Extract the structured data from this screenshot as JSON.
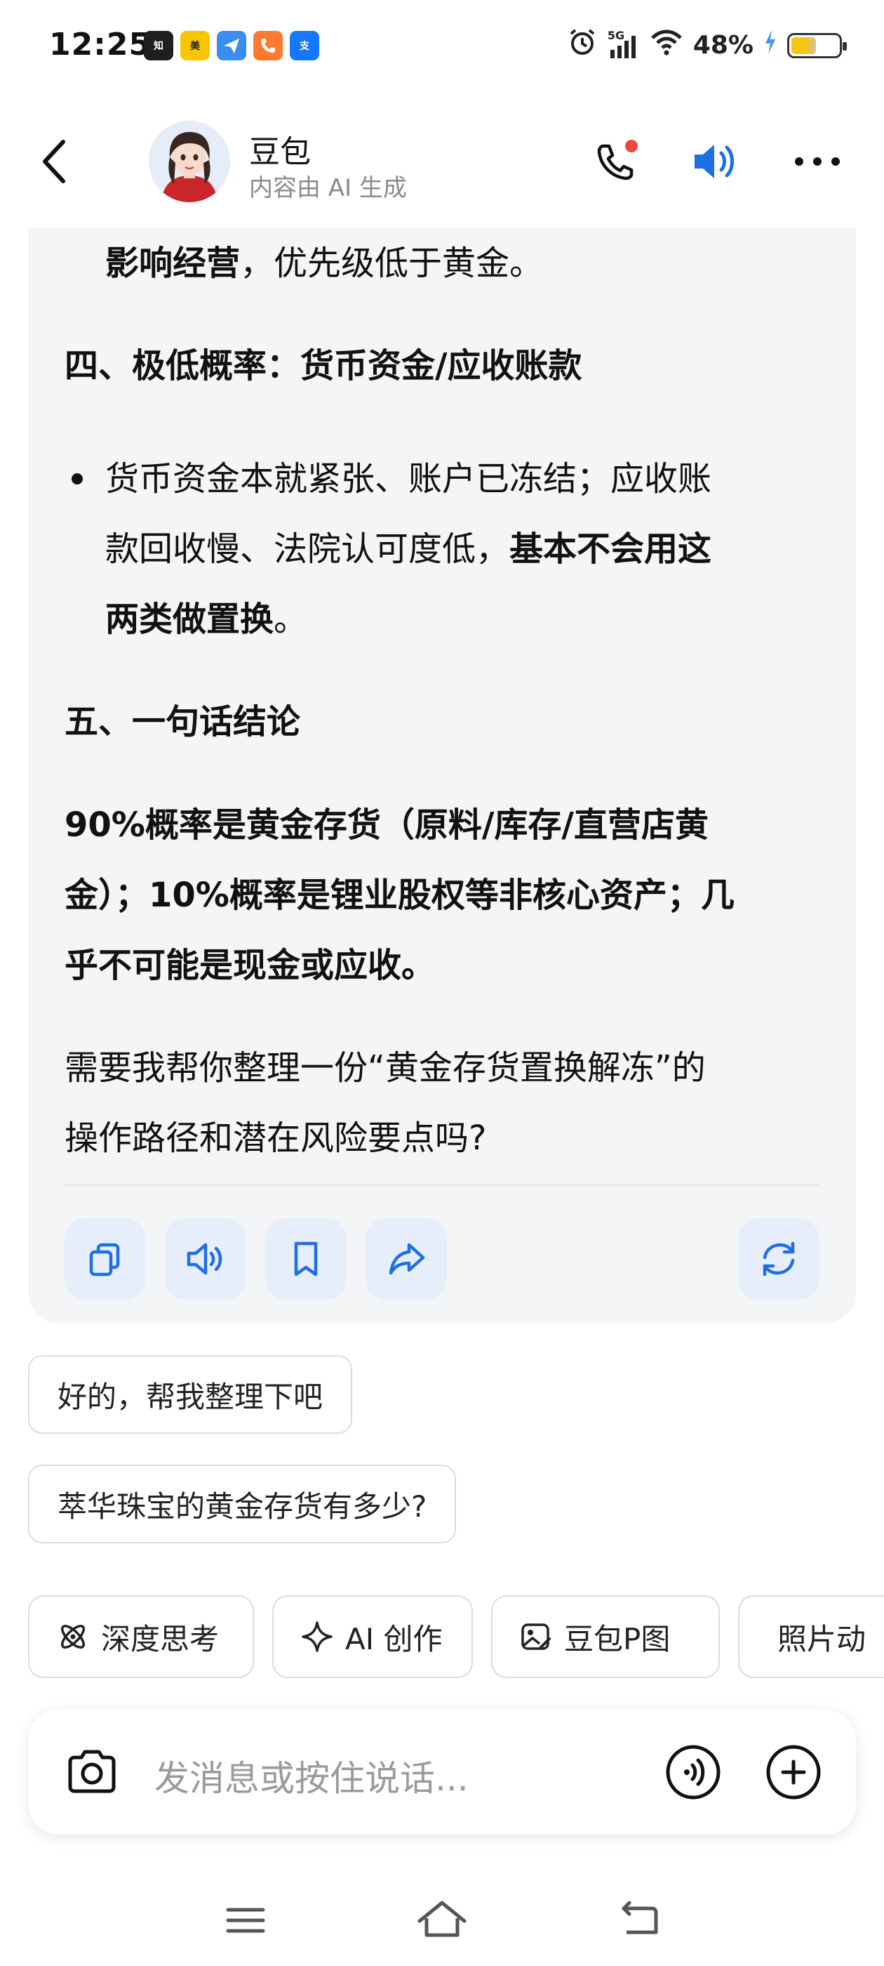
{
  "status_bar": {
    "time": "12:25",
    "network": "5G",
    "battery": "48%",
    "battery_level": 0.48,
    "app_icons": [
      {
        "name": "知乎",
        "color": "#1f1f1f"
      },
      {
        "name": "美团",
        "color": "#f7c600"
      },
      {
        "name": "飞书",
        "color": "#3a8ef0"
      },
      {
        "name": "通话",
        "color": "#ff7a2e"
      },
      {
        "name": "支付宝",
        "color": "#1677ff"
      }
    ]
  },
  "header": {
    "title": "豆包",
    "subtitle": "内容由 AI 生成"
  },
  "message": {
    "line1_bold": "影响经营",
    "line1_rest": "，优先级低于黄金。",
    "section4_heading": "四、极低概率：货币资金/应收账款",
    "bullet_l1": "货币资金本就紧张、账户已冻结；应收账",
    "bullet_l2_normal": "款回收慢、法院认可度低，",
    "bullet_l2_bold": "基本不会用这",
    "bullet_l3_bold": "两类做置换",
    "bullet_l3_end": "。",
    "section5_heading": "五、一句话结论",
    "conclusion_l1": "90%概率是黄金存货（原料/库存/直营店黄",
    "conclusion_l2": "金）；10%概率是锂业股权等非核心资产；几",
    "conclusion_l3": "乎不可能是现金或应收。",
    "question_l1": "需要我帮你整理一份“黄金存货置换解冻”的",
    "question_l2": "操作路径和潜在风险要点吗?"
  },
  "suggestions": [
    "好的，帮我整理下吧",
    "萃华珠宝的黄金存货有多少?"
  ],
  "chips": [
    {
      "label": "深度思考",
      "icon": "atom-icon"
    },
    {
      "label": "AI 创作",
      "icon": "sparkle-icon"
    },
    {
      "label": "豆包P图",
      "icon": "image-edit-icon"
    },
    {
      "label": "照片动",
      "icon": "play-icon"
    }
  ],
  "input": {
    "placeholder": "发消息或按住说话..."
  },
  "colors": {
    "accent": "#1e6fe6",
    "card_bg": "#f4f5f7",
    "action_bg": "#e6eefb",
    "notify_dot": "#f0473c"
  }
}
